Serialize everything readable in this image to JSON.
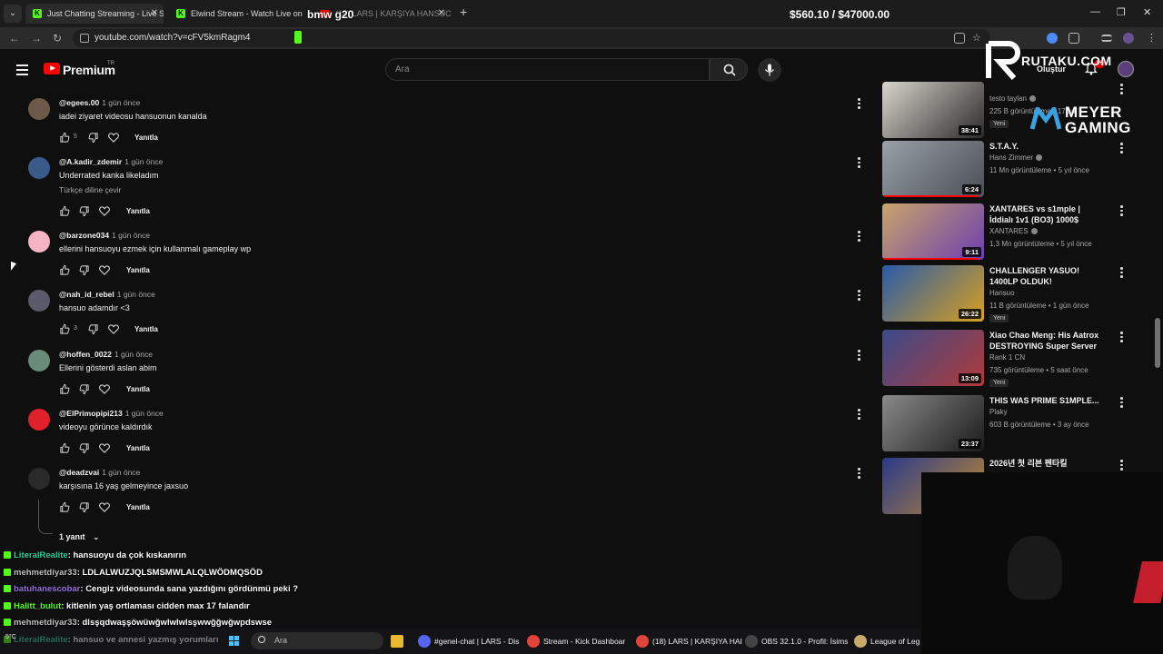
{
  "browser": {
    "tabs": [
      {
        "title": "Just Chatting Streaming - Live S",
        "icon": "kick-icon"
      },
      {
        "title": "Elwind Stream - Watch Live on",
        "icon": "kick-icon"
      },
      {
        "title": "(18) LARS | KARŞIYA HANSUO",
        "icon": "youtube-icon"
      }
    ],
    "overlay_title": "bmw g20",
    "price_ticker": "$560.10 / $47000.00",
    "url": "youtube.com/watch?v=cFV5kmRagm4"
  },
  "youtube_header": {
    "logo_text": "Premium",
    "region": "TR",
    "search_placeholder": "Ara",
    "create_label": "Oluştur",
    "notification_count": "9+"
  },
  "comments": [
    {
      "user": "@egees.00",
      "time": "1 gün önce",
      "text": "iadei ziyaret videosu hansuonun kanalda",
      "likes": "5",
      "reply": "Yanıtla",
      "avatar_color": "#6b5a4a"
    },
    {
      "user": "@A.kadir_zdemir",
      "time": "1 gün önce",
      "text": "Underrated kanka likeladım",
      "translate": "Türkçe diline çevir",
      "likes": "",
      "reply": "Yanıtla",
      "avatar_color": "#3a5a8a"
    },
    {
      "user": "@barzone034",
      "time": "1 gün önce",
      "text": "ellerini hansuoyu ezmek için kullanmalı gameplay wp",
      "likes": "",
      "reply": "Yanıtla",
      "avatar_color": "#f5b3c4"
    },
    {
      "user": "@nah_id_rebel",
      "time": "1 gün önce",
      "text": "hansuo adamdır <3",
      "likes": "3",
      "reply": "Yanıtla",
      "avatar_color": "#5a5a6a"
    },
    {
      "user": "@hoffen_0022",
      "time": "1 gün önce",
      "text": "Ellerini gösterdi aslan abim",
      "likes": "",
      "reply": "Yanıtla",
      "avatar_color": "#6a8a7a"
    },
    {
      "user": "@ElPrimopipi213",
      "time": "1 gün önce",
      "text": "videoyu görünce kaldırdık",
      "likes": "",
      "reply": "Yanıtla",
      "avatar_color": "#e0202a"
    },
    {
      "user": "@deadzvai",
      "time": "1 gün önce",
      "text": "karşısına 16 yaş gelmeyince jaxsuo",
      "likes": "",
      "reply": "Yanıtla",
      "avatar_color": "#2a2a2a"
    }
  ],
  "replies_toggle": "1 yanıt",
  "sidebar": [
    {
      "title": "",
      "channel": "testo taylan",
      "verified": true,
      "meta": "225 B görüntüleme • 17 sa",
      "badge": "Yeni",
      "duration": "38:41",
      "thumb": [
        "#d9d4cc",
        "#2b2b2b"
      ]
    },
    {
      "title": "S.T.A.Y.",
      "channel": "Hans Zimmer",
      "verified": true,
      "meta": "11 Mn görüntüleme • 5 yıl önce",
      "badge": "",
      "duration": "6:24",
      "thumb": [
        "#9aa0a8",
        "#4a4f55"
      ],
      "progress": 0.95
    },
    {
      "title": "XANTARES vs s1mple | İddialı 1v1 (BO3) 1000$",
      "channel": "XANTARES",
      "verified": true,
      "meta": "1,3 Mn görüntüleme • 5 yıl önce",
      "badge": "",
      "duration": "9:11",
      "thumb": [
        "#c9a46a",
        "#6b3fb0"
      ],
      "progress": 0.95
    },
    {
      "title": "CHALLENGER YASUO! 1400LP OLDUK!",
      "channel": "Hansuo",
      "verified": false,
      "meta": "11 B görüntüleme • 1 gün önce",
      "badge": "Yeni",
      "duration": "26:22",
      "thumb": [
        "#2a5aa8",
        "#d8a020"
      ]
    },
    {
      "title": "Xiao Chao Meng: His Aatrox DESTROYING Super Server Hi...",
      "channel": "Rank 1 CN",
      "verified": false,
      "meta": "735 görüntüleme • 5 saat önce",
      "badge": "Yeni",
      "duration": "13:09",
      "thumb": [
        "#3a4a8a",
        "#b03a3a"
      ]
    },
    {
      "title": "THIS WAS PRIME S1MPLE...",
      "channel": "Plaky",
      "verified": false,
      "meta": "603 B görüntüleme • 3 ay önce",
      "badge": "",
      "duration": "23:37",
      "thumb": [
        "#8a8a8a",
        "#1a1a1a"
      ]
    },
    {
      "title": "2026년 첫 리븐 펜타킬",
      "channel": "",
      "verified": false,
      "meta": "",
      "badge": "",
      "duration": "",
      "thumb": [
        "#2a3a8a",
        "#c08a30"
      ]
    }
  ],
  "overlays": {
    "rutaku": "RUTAKU.COM",
    "meyer_line1": "MEYER",
    "meyer_line2": "GAMING"
  },
  "chat": [
    {
      "user": "LiteralRealite",
      "user_color": "#2fd0a0",
      "msg": ": hansuoyu da çok kıskanırın"
    },
    {
      "user": "mehmetdiyar33",
      "user_color": "#c0c0c0",
      "msg": ": LDLALWUZJQLSMSMWLALQLWÖDMQSÖD"
    },
    {
      "user": "batuhanescobar",
      "user_color": "#9a70e0",
      "msg": ": Cengiz videosunda sana yazdığını gördünmü peki ?"
    },
    {
      "user": "Halitt_bulut",
      "user_color": "#53fc18",
      "msg": ": kitlenin yaş ortlaması cidden max 17 falandır"
    },
    {
      "user": "mehmetdiyar33",
      "user_color": "#c0c0c0",
      "msg": ": dlsşqdwaşşöwüwğwlwlwlsşwwğğwğwpdswse"
    },
    {
      "user": "LiteralRealite",
      "user_color": "#2fd0a0",
      "msg": ": hansuo ve annesi yazmış yorumları"
    }
  ],
  "taskbar": {
    "search_placeholder": "Ara",
    "weather": "5°C",
    "items": [
      {
        "label": "#genel-chat | LARS - Dis",
        "icon": "discord-icon",
        "color": "#5865f2"
      },
      {
        "label": "Stream - Kick Dashboar",
        "icon": "chrome-icon",
        "color": "#e0443a"
      },
      {
        "label": "(18) LARS | KARŞIYA HAI",
        "icon": "chrome-icon",
        "color": "#e0443a"
      },
      {
        "label": "OBS 32.1.0 - Profil: İsims",
        "icon": "obs-icon",
        "color": "#444"
      },
      {
        "label": "League of Leg",
        "icon": "league-icon",
        "color": "#c8aa6e"
      }
    ]
  }
}
